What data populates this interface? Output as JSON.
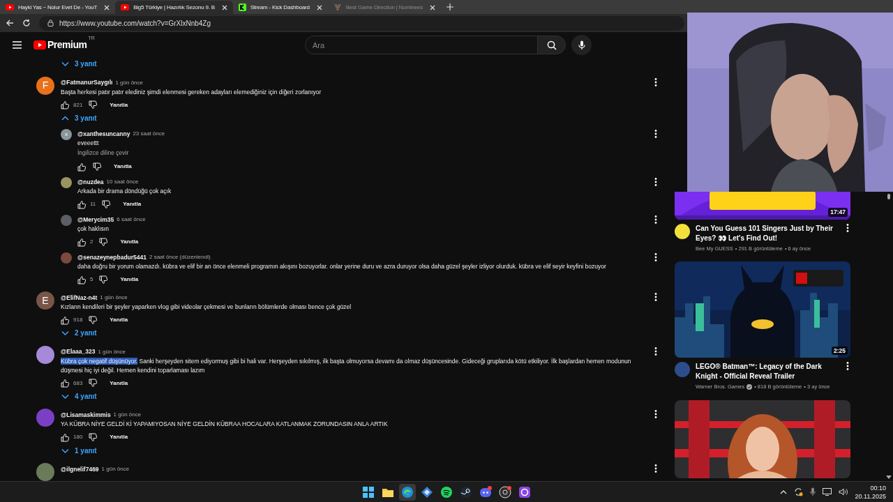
{
  "browser": {
    "tabs": [
      {
        "title": "Hayki Yas ~ Nolur Evet De - YouT",
        "kind": "youtube",
        "selected": false,
        "sleeping": false
      },
      {
        "title": "Big5 Türkiye | Hazırlık Sezonu 9. B",
        "kind": "youtube",
        "selected": true,
        "sleeping": false
      },
      {
        "title": "Stream - Kick Dashboard",
        "kind": "kick",
        "selected": false,
        "sleeping": false
      },
      {
        "title": "Best Game Direction | Nominees",
        "kind": "award",
        "selected": false,
        "sleeping": true
      }
    ],
    "url": "https://www.youtube.com/watch?v=GrXlxNnb4Zg"
  },
  "header": {
    "logo": "Premium",
    "region": "TR",
    "search_placeholder": "Ara"
  },
  "comments": [
    {
      "kind": "toggle",
      "label": "3 yanıt",
      "expanded": false
    },
    {
      "kind": "comment",
      "avatar": {
        "letter": "F",
        "color": "#e8711b"
      },
      "author": "@FatmanurSaygılı",
      "time": "1 gün önce",
      "text": "Başta herkesi patır patır elediniz şimdi elenmesi gereken adayları elemediğiniz için diğeri zorlanıyor",
      "likes": "821",
      "reply_label": "Yanıtla"
    },
    {
      "kind": "toggle",
      "label": "3 yanıt",
      "expanded": true
    },
    {
      "kind": "reply",
      "avatar": {
        "letter": "x",
        "color": "#8a969c"
      },
      "author": "@xanthesuncanny",
      "time": "23 saat önce",
      "text": "eveeettt",
      "translate": "İngilizce diline çevir",
      "reply_label": "Yanıtla"
    },
    {
      "kind": "reply",
      "avatar": {
        "color": "#9a9460"
      },
      "author": "@nuzdea",
      "time": "10 saat önce",
      "text": "Arkada bir drama döndüğü çok açık",
      "likes": "11",
      "reply_label": "Yanıtla"
    },
    {
      "kind": "reply",
      "avatar": {
        "color": "#5c6066"
      },
      "author": "@Merycim35",
      "time": "6 saat önce",
      "text": "çok haklısın",
      "likes": "2",
      "reply_label": "Yanıtla"
    },
    {
      "kind": "reply",
      "avatar": {
        "color": "#7a4a3c"
      },
      "author": "@senazeynepbadur5441",
      "time": "2 saat önce (düzenlendi)",
      "text": "daha doğru bir yorum olamazdı. kübra ve elif bir an önce elenmeli programın akışını bozuyorlar. onlar yerine duru ve azra duruyor olsa daha güzel şeyler izliyor olurduk. kübra ve elif seyir keyfini bozuyor",
      "likes": "5",
      "reply_label": "Yanıtla"
    },
    {
      "kind": "comment",
      "avatar": {
        "letter": "E",
        "color": "#795548"
      },
      "author": "@ElifNaz-n4t",
      "time": "1 gün önce",
      "text": "Kızların kendileri bir şeyler yaparken vlog gibi videolar çekmesi ve bunların bölümlerde olması bence çok güzel",
      "likes": "918",
      "reply_label": "Yanıtla"
    },
    {
      "kind": "toggle",
      "label": "2 yanıt",
      "expanded": false
    },
    {
      "kind": "comment",
      "avatar": {
        "color": "#a48ad8"
      },
      "author": "@Elaaa_323",
      "time": "1 gün önce",
      "text_selected": "Kübra çok negatif düşünüyor.",
      "text": "Sanki herşeyden sitem ediyormuş gibi bi hali var. Herşeyden sıkılmış, ilk başta olmuyorsa devamı da olmaz düşüncesinde. Gideceği gruplarıda kötü etkiliyor. İlk başlardan hemen modunun düşmesi hiç iyi değil. Hemen kendini toparlaması lazım",
      "likes": "683",
      "reply_label": "Yanıtla"
    },
    {
      "kind": "toggle",
      "label": "4 yanıt",
      "expanded": false
    },
    {
      "kind": "comment",
      "avatar": {
        "color": "#7b3fc4"
      },
      "author": "@Lisamaskimmis",
      "time": "1 gün önce",
      "text": "YA KÜBRA NİYE GELDİ Kİ YAPAMIYOSAN NİYE GELDİN KÜBRAA HOCALARA KATLANMAK ZORUNDASIN ANLA ARTIK",
      "likes": "180",
      "reply_label": "Yanıtla"
    },
    {
      "kind": "toggle",
      "label": "1 yanıt",
      "expanded": false
    },
    {
      "kind": "comment",
      "avatar": {
        "color": "#6b7a5a"
      },
      "author": "@ilgnelif7469",
      "time": "1 gün önce"
    }
  ],
  "sidebar": {
    "videos": [
      {
        "kind": "purple",
        "duration": "17:47",
        "title": "Can You Guess 101 Singers Just by Their Eyes? 👀 Let's Find Out!",
        "channel": "Bee My GUESS",
        "verified": false,
        "views": "• 291 B görüntüleme",
        "age": "• 6 ay önce",
        "color": "#f3e03b"
      },
      {
        "kind": "night",
        "duration": "2:25",
        "title": "LEGO® Batman™: Legacy of the Dark Knight - Official Reveal Trailer",
        "channel": "Warner Bros. Games",
        "verified": true,
        "views": "• 818 B görüntüleme",
        "age": "• 3 ay önce",
        "color": "#2d4e8c"
      },
      {
        "kind": "portrait"
      }
    ]
  },
  "taskbar": {
    "apps": [
      {
        "kind": "start",
        "selected": false
      },
      {
        "kind": "folder",
        "selected": false
      },
      {
        "kind": "edge",
        "selected": true
      },
      {
        "kind": "tool",
        "selected": false
      },
      {
        "kind": "spotify",
        "selected": false
      },
      {
        "kind": "steam",
        "selected": false
      },
      {
        "kind": "discord",
        "selected": false
      },
      {
        "kind": "obs",
        "selected": false
      },
      {
        "kind": "ring",
        "selected": false
      }
    ],
    "time": "00:10",
    "date": "20.11.2025"
  }
}
